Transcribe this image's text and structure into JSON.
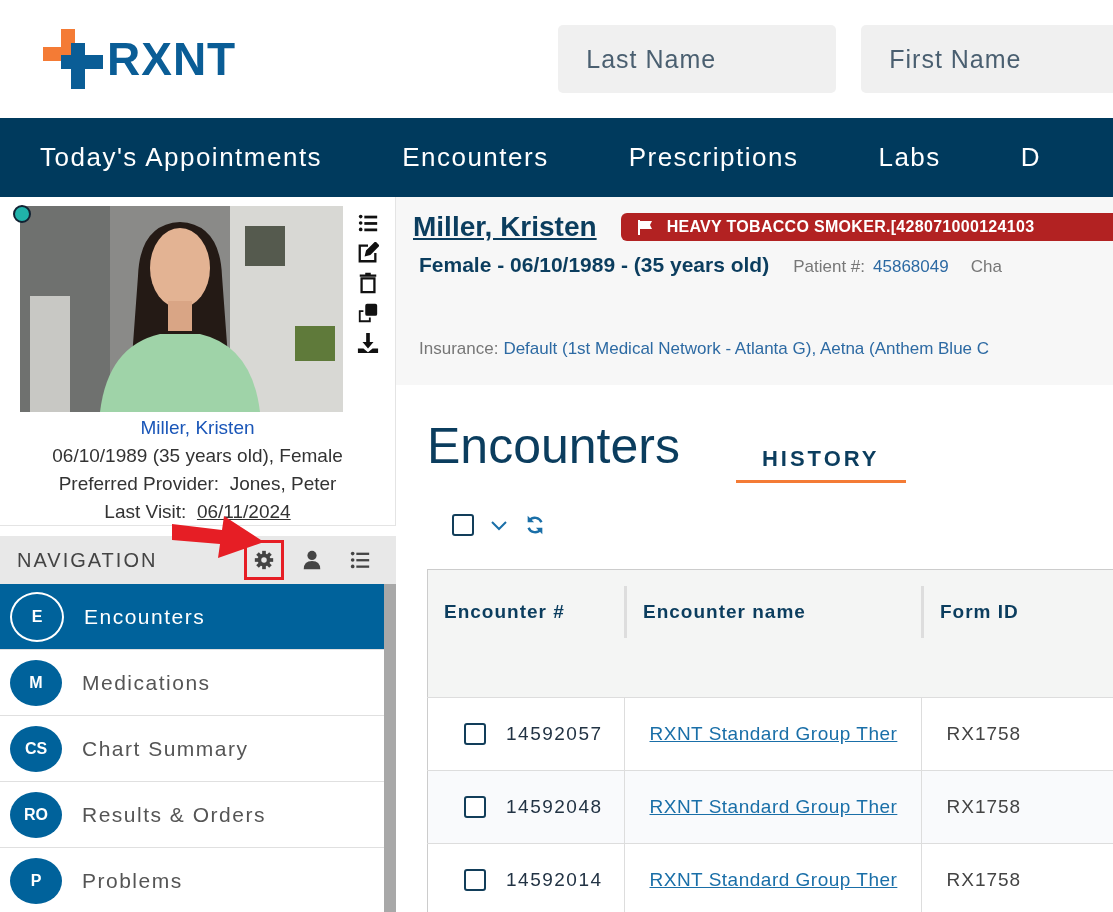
{
  "header": {
    "logo": "RXNT",
    "search_fields": [
      {
        "placeholder": "Last Name"
      },
      {
        "placeholder": "First Name"
      }
    ]
  },
  "menu": [
    {
      "label": "Today's Appointments"
    },
    {
      "label": "Encounters"
    },
    {
      "label": "Prescriptions"
    },
    {
      "label": "Labs"
    },
    {
      "label": "D"
    }
  ],
  "patient_card": {
    "online": true,
    "name": "Miller, Kristen",
    "details": "06/10/1989 (35 years old), Female",
    "provider_label": "Preferred Provider:",
    "provider": "Jones, Peter",
    "last_visit_label": "Last Visit:",
    "last_visit": "06/11/2024"
  },
  "navigation": {
    "title": "NAVIGATION",
    "tools": [
      {
        "kind": "settings",
        "highlighted": true
      },
      {
        "kind": "person",
        "highlighted": false
      },
      {
        "kind": "list",
        "highlighted": false
      }
    ],
    "items": [
      {
        "initials": "E",
        "label": "Encounters",
        "selected": true
      },
      {
        "initials": "M",
        "label": "Medications",
        "selected": false
      },
      {
        "initials": "CS",
        "label": "Chart Summary",
        "selected": false
      },
      {
        "initials": "RO",
        "label": "Results & Orders",
        "selected": false
      },
      {
        "initials": "P",
        "label": "Problems",
        "selected": false
      }
    ]
  },
  "patient_header": {
    "name": "Miller, Kristen",
    "alert": "HEAVY TOBACCO SMOKER.[428071000124103",
    "summary": "Female - 06/10/1989 - (35 years old)",
    "patient_no_label": "Patient #:",
    "patient_no": "45868049",
    "chart_label": "Cha",
    "insurance_label": "Insurance:",
    "insurance": "Default (1st Medical Network - Atlanta G), Aetna (Anthem Blue C"
  },
  "page": {
    "title": "Encounters",
    "tabs": [
      {
        "label": "HISTORY",
        "selected": true
      }
    ],
    "select_all": {
      "checked": false
    }
  },
  "table": {
    "columns": [
      "Encounter #",
      "Encounter name",
      "Form ID"
    ],
    "rows": [
      {
        "checked": false,
        "number": "14592057",
        "name": "RXNT Standard Group Ther",
        "form_id": "RX1758"
      },
      {
        "checked": false,
        "number": "14592048",
        "name": "RXNT Standard Group Ther",
        "form_id": "RX1758"
      },
      {
        "checked": false,
        "number": "14592014",
        "name": "RXNT Standard Group Ther",
        "form_id": "RX1758"
      }
    ]
  }
}
